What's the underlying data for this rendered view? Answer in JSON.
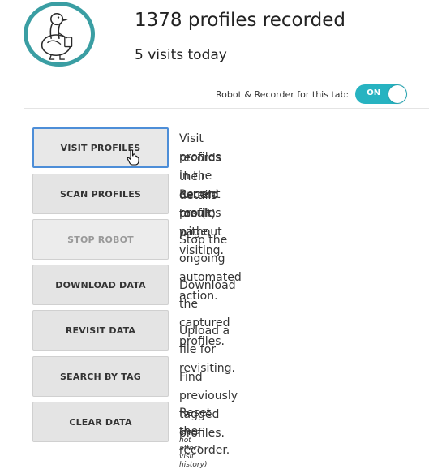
{
  "header": {
    "profiles_recorded": "1378 profiles recorded",
    "visits_today": "5 visits today"
  },
  "toggle": {
    "label": "Robot & Recorder for this tab:",
    "state": "ON"
  },
  "actions": [
    {
      "label": "VISIT PROFILES",
      "desc1": "Visit profiles in the current result page,",
      "desc2": "records their details too (*)."
    },
    {
      "label": "SCAN PROFILES",
      "desc1": "Record profiles without visiting."
    },
    {
      "label": "STOP ROBOT",
      "desc1": "Stop the ongoing automated action."
    },
    {
      "label": "DOWNLOAD DATA",
      "desc1": "Download the captured profiles."
    },
    {
      "label": "REVISIT DATA",
      "desc1": "Upload a file for revisiting."
    },
    {
      "label": "SEARCH BY TAG",
      "desc1": "Find previously tagged profiles."
    },
    {
      "label": "CLEAR DATA",
      "desc1": "Reset the recorder.",
      "note": "(does not affect visit history)"
    }
  ],
  "colors": {
    "accent": "#27b3c1",
    "logo_ring": "#3a9ea3",
    "focus": "#4d8ed8",
    "button_bg": "#e4e4e4"
  },
  "icons": {
    "logo": "duck-logo-icon",
    "cursor": "hand-pointer-icon"
  }
}
